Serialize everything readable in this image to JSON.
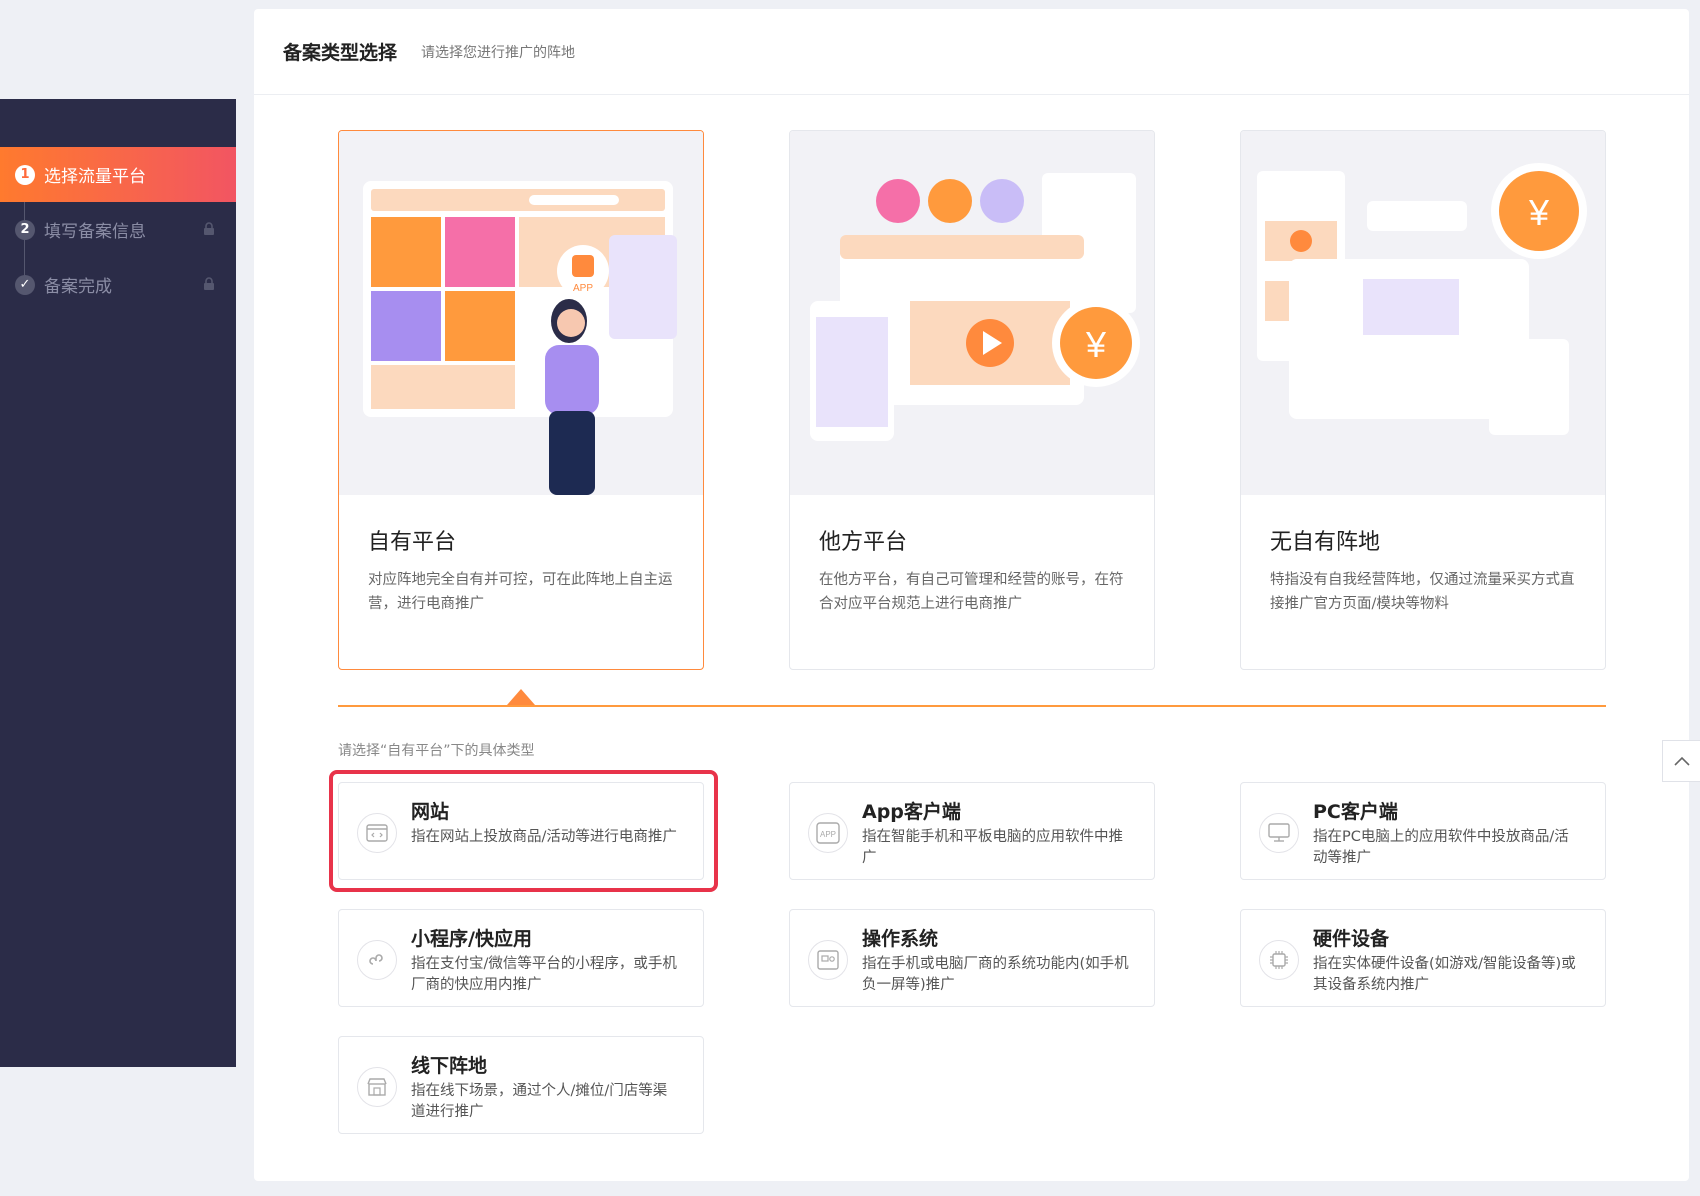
{
  "sidebar": {
    "steps": [
      {
        "num": "1",
        "label": "选择流量平台",
        "active": true
      },
      {
        "num": "2",
        "label": "填写备案信息",
        "locked": true
      },
      {
        "num": "✓",
        "label": "备案完成",
        "locked": true
      }
    ]
  },
  "header": {
    "title": "备案类型选择",
    "subtitle": "请选择您进行推广的阵地"
  },
  "platforms": [
    {
      "title": "自有平台",
      "desc": "对应阵地完全自有并可控，可在此阵地上自主运营，进行电商推广",
      "selected": true
    },
    {
      "title": "他方平台",
      "desc": "在他方平台，有自己可管理和经营的账号，在符合对应平台规范上进行电商推广"
    },
    {
      "title": "无自有阵地",
      "desc": "特指没有自我经营阵地，仅通过流量采买方式直接推广官方页面/模块等物料"
    }
  ],
  "illus_text": {
    "app": "APP",
    "yen": "¥",
    "app_icon": "APP"
  },
  "sub_hint": "请选择“自有平台”下的具体类型",
  "types": [
    {
      "title": "网站",
      "desc": "指在网站上投放商品/活动等进行电商推广",
      "icon": "code-browser-icon"
    },
    {
      "title": "App客户端",
      "desc": "指在智能手机和平板电脑的应用软件中推广",
      "icon": "app-icon"
    },
    {
      "title": "PC客户端",
      "desc": "指在PC电脑上的应用软件中投放商品/活动等推广",
      "icon": "monitor-icon"
    },
    {
      "title": "小程序/快应用",
      "desc": "指在支付宝/微信等平台的小程序，或手机厂商的快应用内推广",
      "icon": "mini-program-icon"
    },
    {
      "title": "操作系统",
      "desc": "指在手机或电脑厂商的系统功能内(如手机负一屏等)推广",
      "icon": "os-icon"
    },
    {
      "title": "硬件设备",
      "desc": "指在实体硬件设备(如游戏/智能设备等)或其设备系统内推广",
      "icon": "chip-icon"
    },
    {
      "title": "线下阵地",
      "desc": "指在线下场景，通过个人/摊位/门店等渠道进行推广",
      "icon": "store-icon"
    }
  ],
  "colors": {
    "accent": "#ff7a2e",
    "sidebar": "#2b2c48",
    "highlight": "#e8334a"
  }
}
